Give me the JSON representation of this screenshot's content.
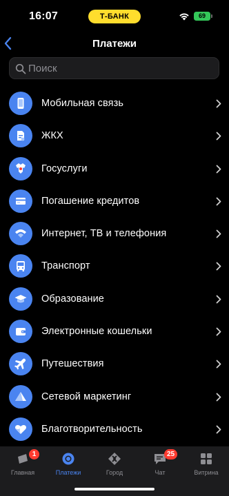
{
  "status_bar": {
    "time": "16:07",
    "bank_label": "Т-БАНК",
    "battery": "69",
    "accent": "#ffdd2d"
  },
  "header": {
    "title": "Платежи",
    "back_icon": "chevron-left-icon"
  },
  "search": {
    "placeholder": "Поиск",
    "value": ""
  },
  "categories": [
    {
      "label": "Мобильная связь",
      "icon": "phone-icon"
    },
    {
      "label": "ЖКХ",
      "icon": "house-bill-icon"
    },
    {
      "label": "Госуслуги",
      "icon": "eagle-emblem-icon"
    },
    {
      "label": "Погашение кредитов",
      "icon": "credit-card-icon"
    },
    {
      "label": "Интернет, ТВ и телефония",
      "icon": "wifi-icon"
    },
    {
      "label": "Транспорт",
      "icon": "bus-icon"
    },
    {
      "label": "Образование",
      "icon": "graduation-cap-icon"
    },
    {
      "label": "Электронные кошельки",
      "icon": "wallet-icon"
    },
    {
      "label": "Путешествия",
      "icon": "airplane-icon"
    },
    {
      "label": "Сетевой маркетинг",
      "icon": "pyramid-icon"
    },
    {
      "label": "Благотворительность",
      "icon": "heart-icon"
    }
  ],
  "tabbar": {
    "items": [
      {
        "label": "Главная",
        "icon": "home-card-icon",
        "badge": "1"
      },
      {
        "label": "Платежи",
        "icon": "payments-circle-icon",
        "active": true
      },
      {
        "label": "Город",
        "icon": "city-diamond-icon"
      },
      {
        "label": "Чат",
        "icon": "chat-bubble-icon",
        "badge": "25"
      },
      {
        "label": "Витрина",
        "icon": "grid-icon"
      }
    ]
  },
  "colors": {
    "background": "#000000",
    "icon_circle": "#4a84f0",
    "tabbar": "#1c1c1e",
    "badge": "#ff3b30",
    "battery": "#34c759"
  }
}
